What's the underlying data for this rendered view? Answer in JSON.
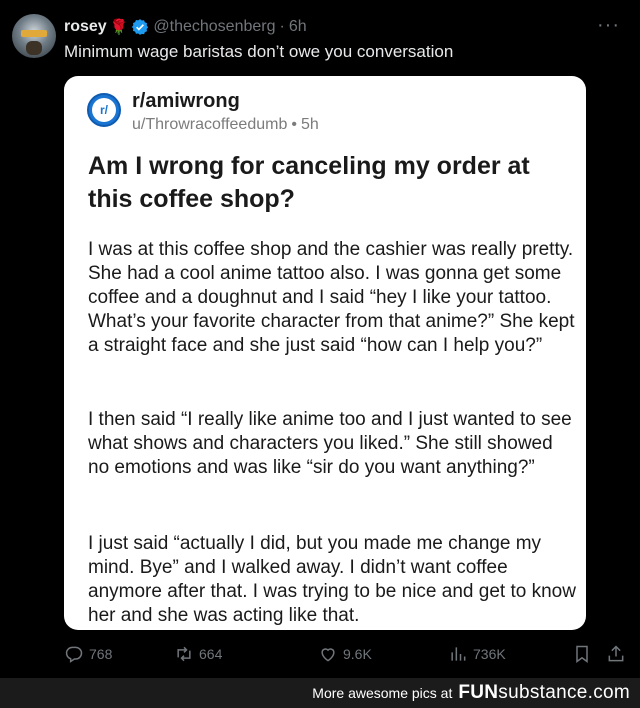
{
  "tweet": {
    "display_name": "rosey",
    "emoji": "🌹",
    "handle": "@thechosenberg",
    "separator": "·",
    "time": "6h",
    "text": "Minimum wage baristas don’t owe you conversation",
    "more_label": "···"
  },
  "post": {
    "icon_text": "r/",
    "subreddit": "r/amiwrong",
    "user": "u/Throwracoffeedumb",
    "separator": "•",
    "age": "5h",
    "title": "Am I wrong for canceling my order at this coffee shop?",
    "paragraph1": "I was at this coffee shop and the cashier was really pretty. She had a cool anime tattoo also. I was gonna get some coffee and a doughnut and I said “hey I like your tattoo. What’s your favorite character from that anime?” She kept a straight face and she just said “how can I help you?”",
    "paragraph2": "I then said “I really like anime too and I just wanted to see what shows and characters you liked.” She still showed no emotions and was like “sir do you want anything?”",
    "paragraph3": "I just said “actually I did, but you made me change my mind. Bye” and I walked away. I didn’t want coffee anymore after that. I was trying to be nice and get to know her and she was acting like that."
  },
  "actions": {
    "replies": "768",
    "retweets": "664",
    "likes": "9.6K",
    "views": "736K"
  },
  "footer": {
    "text": "More awesome pics at",
    "logo_bold": "FUN",
    "logo_light": "substance",
    "logo_suffix": ".com"
  },
  "colors": {
    "background": "#000000",
    "verified": "#1d9bf0",
    "subreddit_icon": "#1a75d2",
    "muted": "#71767b"
  }
}
